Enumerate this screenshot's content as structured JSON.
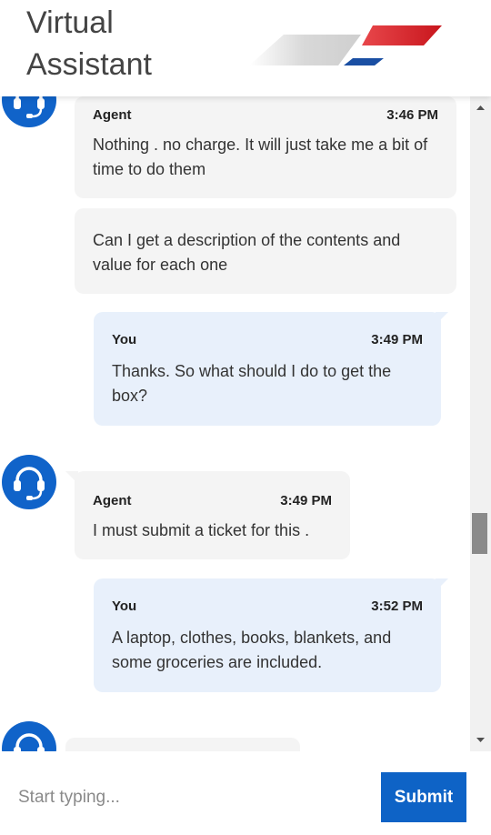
{
  "header": {
    "title_line1": "Virtual",
    "title_line2": "Assistant",
    "logo_icon": "airline-logo-icon",
    "colors": {
      "red": "#d62a2e",
      "blue": "#1a4fa3",
      "gray": "#d6d6d6"
    }
  },
  "messages": [
    {
      "role": "agent",
      "sender": "Agent",
      "time": "3:46 PM",
      "text": "Nothing . no charge. It will just take me a bit of time to do them"
    },
    {
      "role": "agent",
      "sender": "",
      "time": "",
      "text": "Can I get a description of the contents and value for each one"
    },
    {
      "role": "user",
      "sender": "You",
      "time": "3:49 PM",
      "text": "Thanks. So what should I do to get the box?"
    },
    {
      "role": "agent",
      "sender": "Agent",
      "time": "3:49 PM",
      "text": "I must submit a ticket for this ."
    },
    {
      "role": "user",
      "sender": "You",
      "time": "3:52 PM",
      "text": "A laptop, clothes, books, blankets, and some groceries are included."
    }
  ],
  "avatar_icon": "headset-icon",
  "composer": {
    "placeholder": "Start typing...",
    "value": "",
    "submit_label": "Submit"
  },
  "colors": {
    "accent": "#0e63c6",
    "agent_bubble": "#f4f4f4",
    "user_bubble": "#e8f0fb"
  }
}
